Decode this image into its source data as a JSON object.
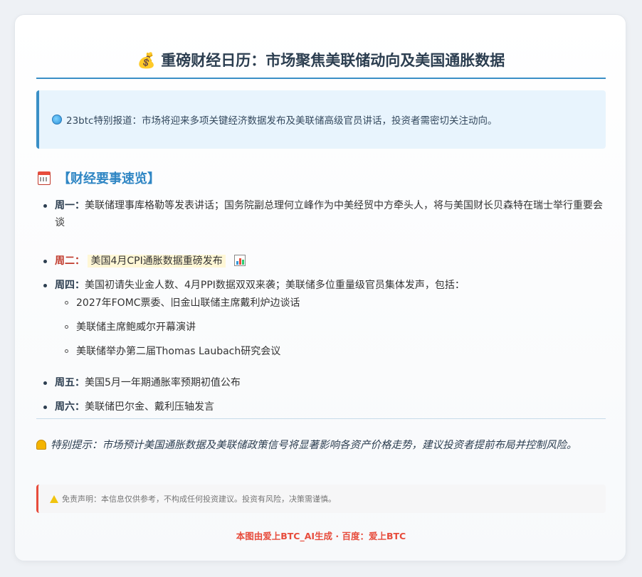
{
  "title": {
    "icon": "money-bag-icon",
    "text": "💰 重磅财经日历：市场聚焦美联储动向及美国通胀数据"
  },
  "notice": {
    "icon": "globe-icon",
    "text": "23btc特别报道：市场将迎来多项关键经济数据发布及美联储高级官员讲话，投资者需密切关注动向。"
  },
  "section": {
    "icon": "calendar-icon",
    "heading": "【财经要事速览】"
  },
  "events": [
    {
      "day": "周一：",
      "text": "美联储理事库格勒等发表讲话；国务院副总理何立峰作为中美经贸中方牵头人，将与美国财长贝森特在瑞士举行重要会谈"
    },
    {
      "day": "周二：",
      "text": "美国4月CPI通胀数据重磅发布",
      "icon": "bar-chart-icon"
    },
    {
      "day": "周四：",
      "text": "美国初请失业金人数、4月PPI数据双双来袭；美联储多位重量级官员集体发声，包括：",
      "sub": [
        "2027年FOMC票委、旧金山联储主席戴利炉边谈话",
        "美联储主席鲍威尔开幕演讲",
        "美联储举办第二届Thomas Laubach研究会议"
      ]
    },
    {
      "day": "周五：",
      "text": "美国5月一年期通胀率预期初值公布"
    },
    {
      "day": "周六：",
      "text": "美联储巴尔金、戴利压轴发言"
    }
  ],
  "tip": {
    "icon": "bell-icon",
    "text": "特别提示：市场预计美国通胀数据及美联储政策信号将显著影响各资产价格走势，建议投资者提前布局并控制风险。"
  },
  "disclaimer": {
    "icon": "warning-icon",
    "text": "免责声明：本信息仅供参考，不构成任何投资建议。投资有风险，决策需谨慎。"
  },
  "footer": {
    "text": "本图由爱上BTC_AI生成 · 百度：爱上BTC"
  },
  "colors": {
    "accent": "#3a8fc6",
    "heading": "#2f86c4",
    "highlight_day": "#c0392b",
    "footer": "#e74c3c"
  }
}
